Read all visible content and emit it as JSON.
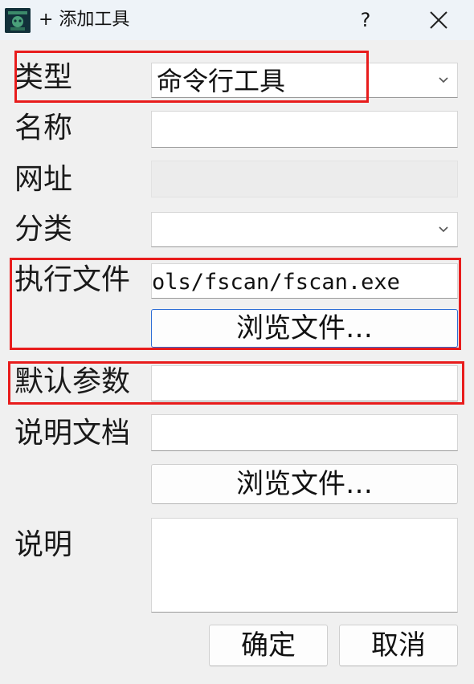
{
  "window": {
    "title": "+ 添加工具",
    "help_label": "?",
    "close_icon": "close-icon"
  },
  "form": {
    "type": {
      "label": "类型",
      "value": "命令行工具"
    },
    "name": {
      "label": "名称",
      "value": ""
    },
    "url": {
      "label": "网址",
      "value": ""
    },
    "category": {
      "label": "分类",
      "value": ""
    },
    "executable": {
      "label": "执行文件",
      "value": "ols/fscan/fscan.exe",
      "browse_label": "浏览文件…"
    },
    "default_args": {
      "label": "默认参数",
      "value": ""
    },
    "doc": {
      "label": "说明文档",
      "value": "",
      "browse_label": "浏览文件…"
    },
    "description": {
      "label": "说明",
      "value": ""
    }
  },
  "footer": {
    "ok_label": "确定",
    "cancel_label": "取消"
  },
  "colors": {
    "highlight": "#e81c1c",
    "focus": "#2f6fd6",
    "background": "#f0f0f0"
  }
}
